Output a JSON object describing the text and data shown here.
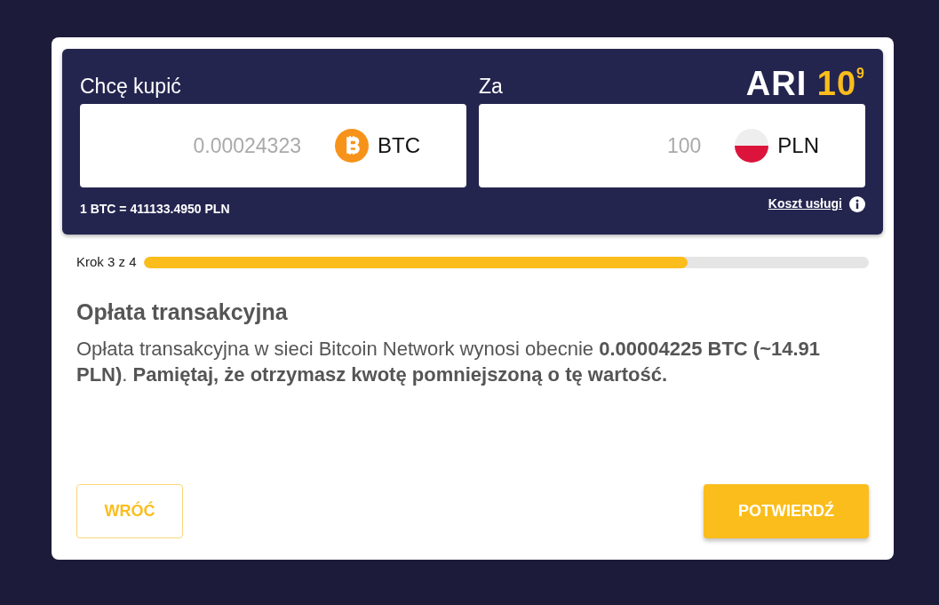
{
  "logo": {
    "word": "ARI",
    "number": "10",
    "exponent": "9"
  },
  "buy": {
    "label": "Chcę kupić",
    "value": "0.00024323",
    "currency": "BTC",
    "rate": "1 BTC = 411133.4950 PLN"
  },
  "pay": {
    "label": "Za",
    "value": "100",
    "currency": "PLN",
    "link": "Koszt usługi"
  },
  "progress": {
    "label": "Krok 3 z 4",
    "level": 0.75
  },
  "step": {
    "title": "Opłata transakcyjna",
    "text": "Opłata transakcyjna w sieci Bitcoin Network wynosi obecnie **0.00004225 BTC (~14.91 PLN)**. **Pamiętaj, że otrzymasz kwotę pomniejszoną o tę wartość.**"
  },
  "buttons": [
    {
      "label": "WRÓĆ",
      "kind": "outline"
    },
    {
      "label": "POTWIERDŹ",
      "kind": "primary"
    }
  ]
}
